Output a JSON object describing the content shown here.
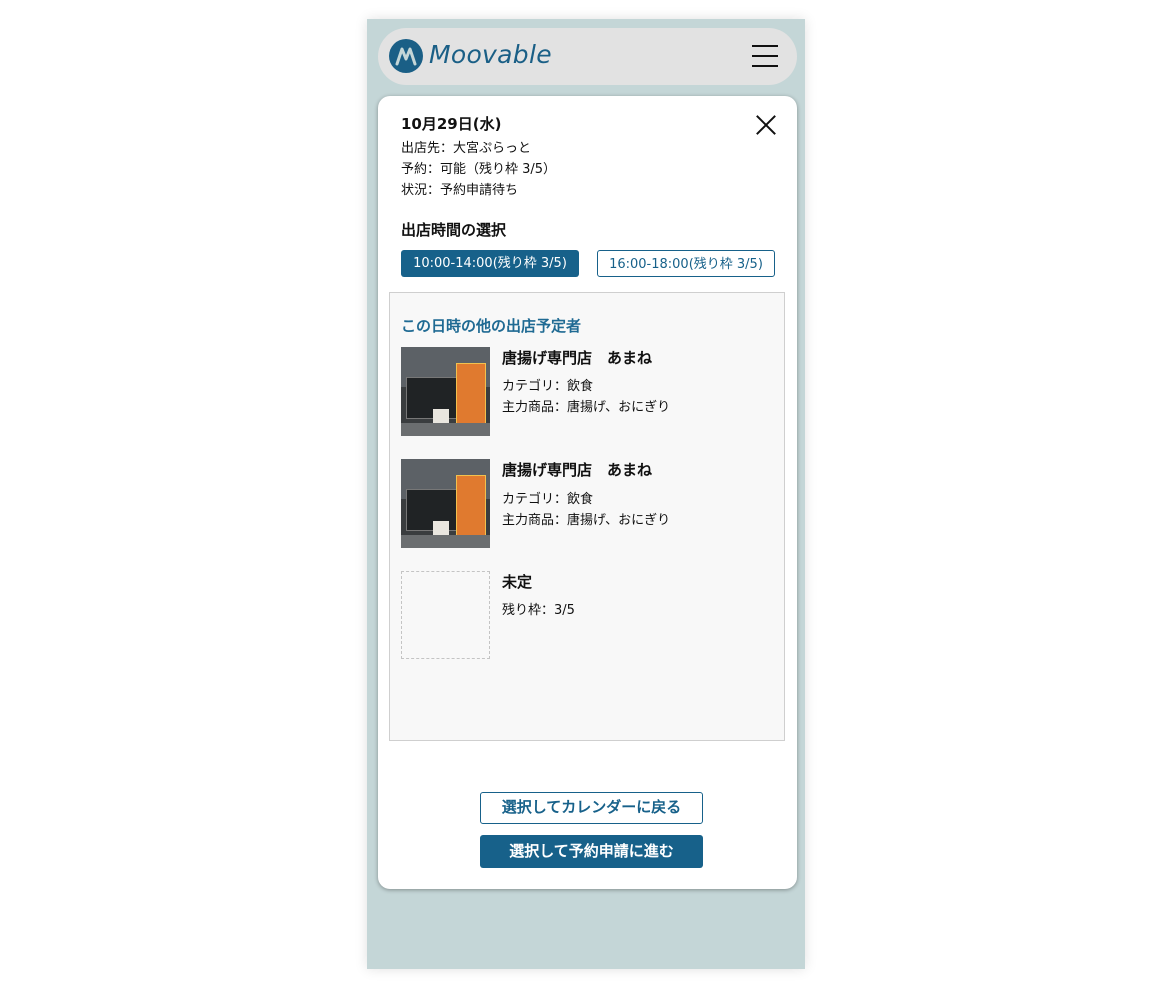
{
  "header": {
    "logo_text": "Moovable",
    "logo_icon": "moovable-logo-icon",
    "menu_icon": "hamburger-menu-icon"
  },
  "modal": {
    "date": "10月29日(水)",
    "location": "出店先：大宮ぷらっと",
    "reservation": "予約：可能（残り枠 3/5）",
    "status": "状況：予約申請待ち",
    "close_icon": "close-icon",
    "time_section_title": "出店時間の選択",
    "slots": [
      {
        "label": "10:00-14:00(残り枠 3/5)",
        "selected": true
      },
      {
        "label": "16:00-18:00(残り枠 3/5)",
        "selected": false
      }
    ],
    "others_title": "この日時の他の出店予定者",
    "vendors": [
      {
        "name": "唐揚げ専門店　あまね",
        "category": "カテゴリ：飲食",
        "main_product": "主力商品：唐揚げ、おにぎり"
      },
      {
        "name": "唐揚げ専門店　あまね",
        "category": "カテゴリ：飲食",
        "main_product": "主力商品：唐揚げ、おにぎり"
      },
      {
        "name": "未定",
        "remaining": "残り枠：3/5"
      }
    ],
    "back_button": "選択してカレンダーに戻る",
    "next_button": "選択して予約申請に進む"
  },
  "colors": {
    "accent": "#17618a",
    "phone_bg": "#c4d6d7",
    "header_bg": "#e2e2e2"
  }
}
